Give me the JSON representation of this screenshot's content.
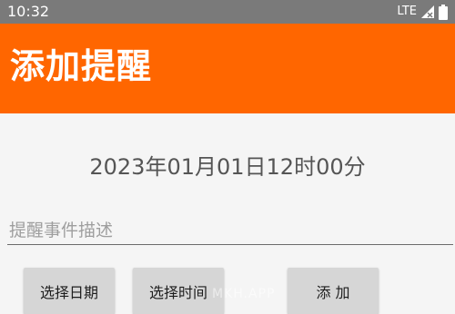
{
  "status_bar": {
    "time": "10:32",
    "network": "LTE",
    "signal_icon": "signal-icon",
    "battery_icon": "battery-icon"
  },
  "app_bar": {
    "title": "添加提醒",
    "color": "#ff6600"
  },
  "datetime_display": "2023年01月01日12时00分",
  "event_input": {
    "value": "",
    "placeholder": "提醒事件描述"
  },
  "buttons": {
    "select_date": "选择日期",
    "select_time": "选择时间",
    "add": "添 加"
  },
  "watermark": "MKH.APP"
}
